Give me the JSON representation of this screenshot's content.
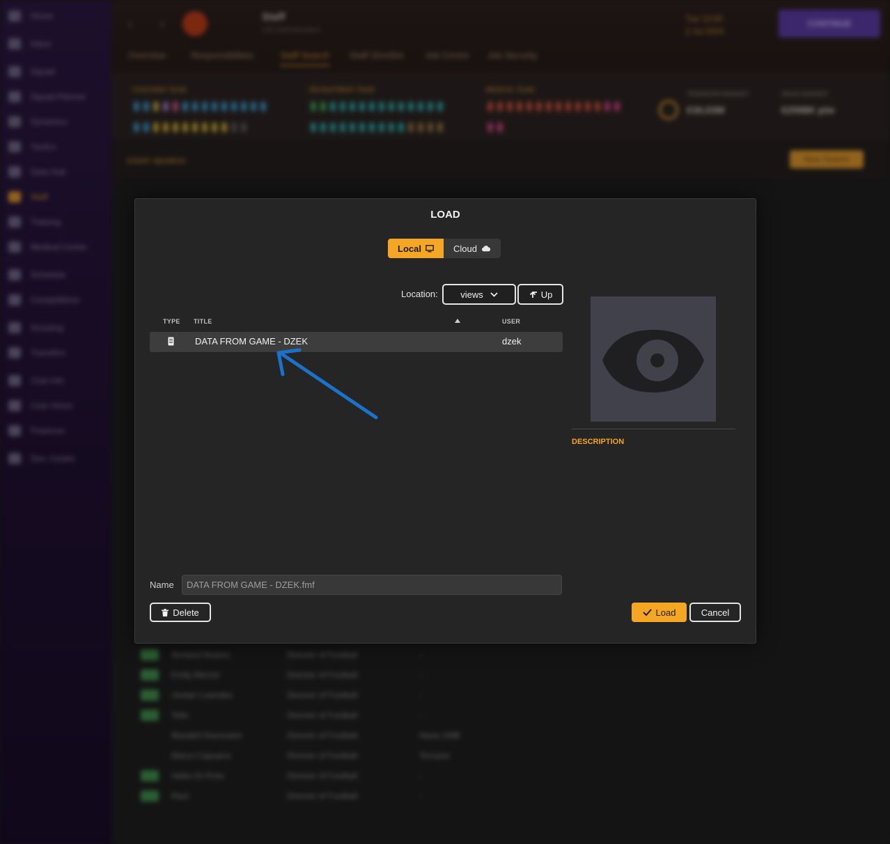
{
  "background": {
    "sidebar": [
      "Home",
      "Inbox",
      "Squad",
      "Squad Planner",
      "Dynamics",
      "Tactics",
      "Data Hub",
      "Staff",
      "Training",
      "Medical Centre",
      "Schedule",
      "Competitions",
      "Scouting",
      "Transfers",
      "Club Info",
      "Club Vision",
      "Finances",
      "Dev. Centre"
    ],
    "active_sidebar": "Staff",
    "header": {
      "title": "Staff",
      "subtitle": "136 Staff Members",
      "date_line1": "Tue 13:00",
      "date_line2": "2 Jul 2024",
      "continue_label": "CONTINUE"
    },
    "tabs": [
      "Overview",
      "Responsibilities",
      "Staff Search",
      "Staff Shortlist",
      "Job Centre",
      "Job Security"
    ],
    "active_tab": "Staff Search",
    "team_labels": [
      "COACHING TEAM",
      "RECRUITMENT TEAM",
      "MEDICAL TEAM"
    ],
    "budget": {
      "transfer_label": "TRANSFER BUDGET",
      "transfer_value": "€30,03M",
      "wage_label": "WAGE BUDGET",
      "wage_value": "€2598K p/w"
    },
    "staff_search_label": "STAFF SEARCH",
    "new_search_label": "New Search",
    "rows": [
      {
        "name": "Armand Alvarez",
        "role": "Director of Football",
        "club": "-",
        "tag": true
      },
      {
        "name": "Emily Mercer",
        "role": "Director of Football",
        "club": "-",
        "tag": true
      },
      {
        "name": "Jordan Lowndes",
        "role": "Director of Football",
        "club": "-",
        "tag": true
      },
      {
        "name": "Tello",
        "role": "Director of Football",
        "club": "-",
        "tag": true
      },
      {
        "name": "Mandell Deennaert",
        "role": "Director of Football",
        "club": "Nana UMB",
        "tag": false
      },
      {
        "name": "Marco Capuano",
        "role": "Director of Football",
        "club": "Ternana",
        "tag": false
      },
      {
        "name": "Heiko Di Pinto",
        "role": "Director of Football",
        "club": "-",
        "tag": true
      },
      {
        "name": "Raul",
        "role": "Director of Football",
        "club": "-",
        "tag": true
      }
    ]
  },
  "dialog": {
    "title": "LOAD",
    "source_tabs": {
      "local": "Local",
      "cloud": "Cloud"
    },
    "location_label": "Location:",
    "location_value": "views",
    "up_label": "Up",
    "columns": {
      "type": "TYPE",
      "title": "TITLE",
      "user": "USER"
    },
    "files": [
      {
        "type_icon": "file-icon",
        "title": "DATA FROM GAME - DZEK",
        "user": "dzek"
      }
    ],
    "preview_icon": "eye-icon",
    "description_label": "DESCRIPTION",
    "name_label": "Name",
    "name_value": "DATA FROM GAME - DZEK.fmf",
    "delete_label": "Delete",
    "load_label": "Load",
    "cancel_label": "Cancel"
  },
  "colors": {
    "accent": "#f5a623",
    "dialog_bg": "#252525",
    "arrow": "#1a73c9"
  }
}
